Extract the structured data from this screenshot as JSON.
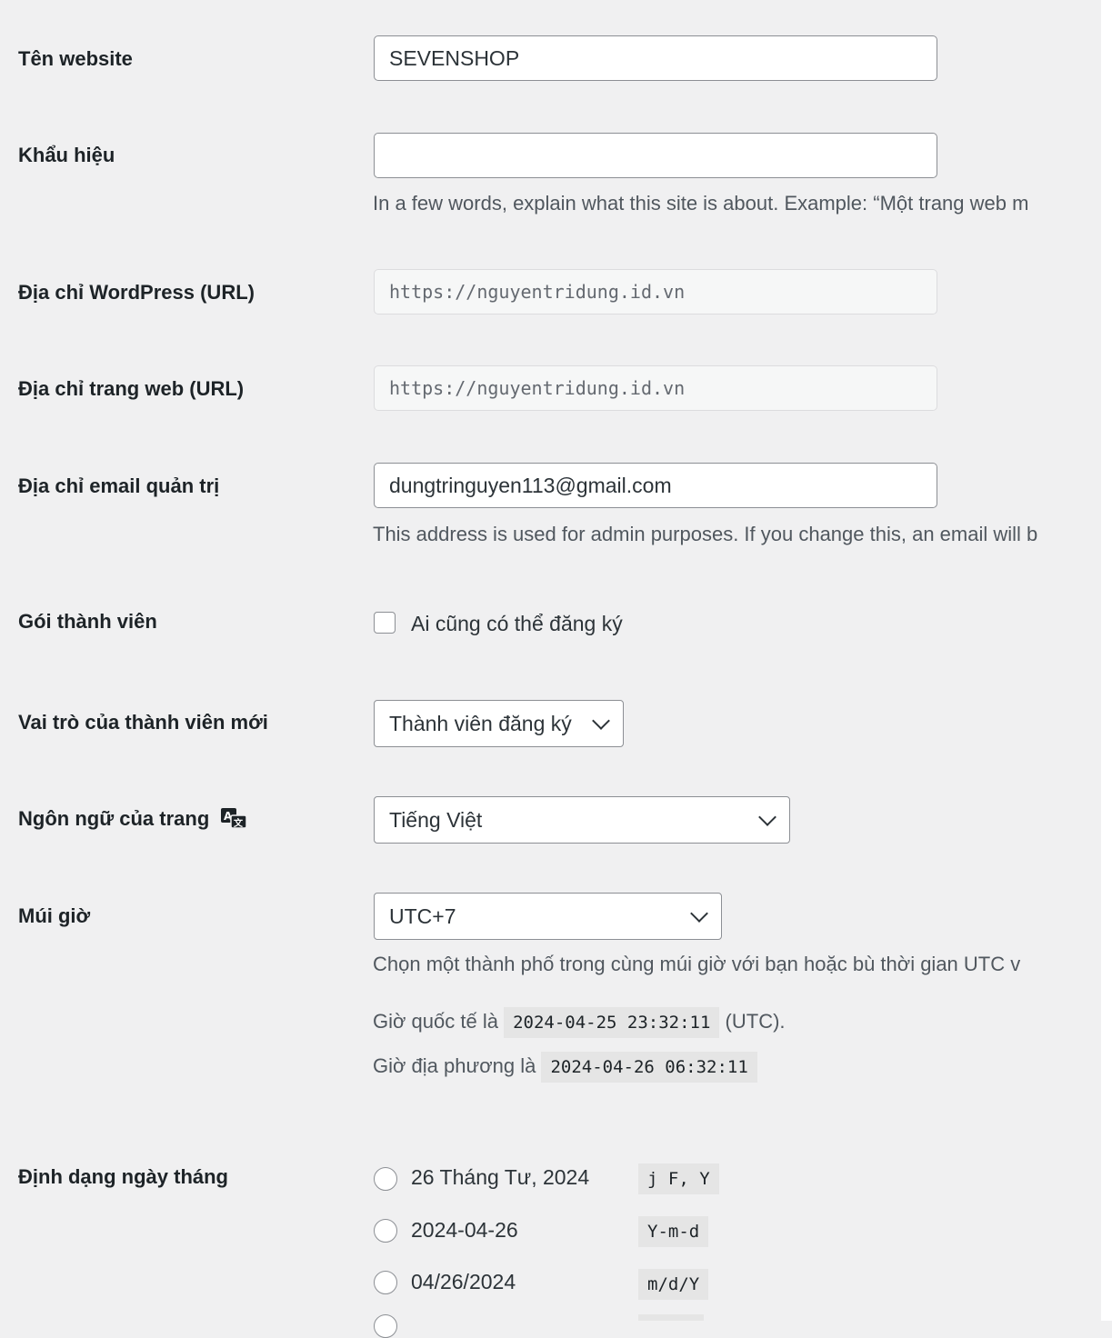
{
  "fields": {
    "site_title": {
      "label": "Tên website",
      "value": "SEVENSHOP"
    },
    "tagline": {
      "label": "Khẩu hiệu",
      "value": "",
      "description": "In a few words, explain what this site is about. Example: “Một trang web m"
    },
    "wp_url": {
      "label": "Địa chỉ WordPress (URL)",
      "value": "https://nguyentridung.id.vn"
    },
    "site_url": {
      "label": "Địa chỉ trang web (URL)",
      "value": "https://nguyentridung.id.vn"
    },
    "admin_email": {
      "label": "Địa chỉ email quản trị",
      "value": "dungtringuyen113@gmail.com",
      "description": "This address is used for admin purposes. If you change this, an email will b"
    },
    "membership": {
      "label": "Gói thành viên",
      "checkbox_label": "Ai cũng có thể đăng ký",
      "checked": false
    },
    "default_role": {
      "label": "Vai trò của thành viên mới",
      "selected": "Thành viên đăng ký"
    },
    "site_language": {
      "label": "Ngôn ngữ của trang",
      "selected": "Tiếng Việt",
      "icon": "translation-icon"
    },
    "timezone": {
      "label": "Múi giờ",
      "selected": "UTC+7",
      "description": "Chọn một thành phố trong cùng múi giờ với bạn hoặc bù thời gian UTC v",
      "utc_prefix": "Giờ quốc tế là",
      "utc_time": "2024-04-25 23:32:11",
      "utc_suffix": "(UTC).",
      "local_prefix": "Giờ địa phương là",
      "local_time": "2024-04-26 06:32:11"
    },
    "date_format": {
      "label": "Định dạng ngày tháng",
      "options": [
        {
          "text": "26 Tháng Tư, 2024",
          "format": "j F, Y"
        },
        {
          "text": "2024-04-26",
          "format": "Y-m-d"
        },
        {
          "text": "04/26/2024",
          "format": "m/d/Y"
        }
      ]
    }
  },
  "colors": {
    "background": "#f0f0f1",
    "border": "#8c8f94",
    "text": "#1d2327",
    "muted": "#50575e"
  }
}
